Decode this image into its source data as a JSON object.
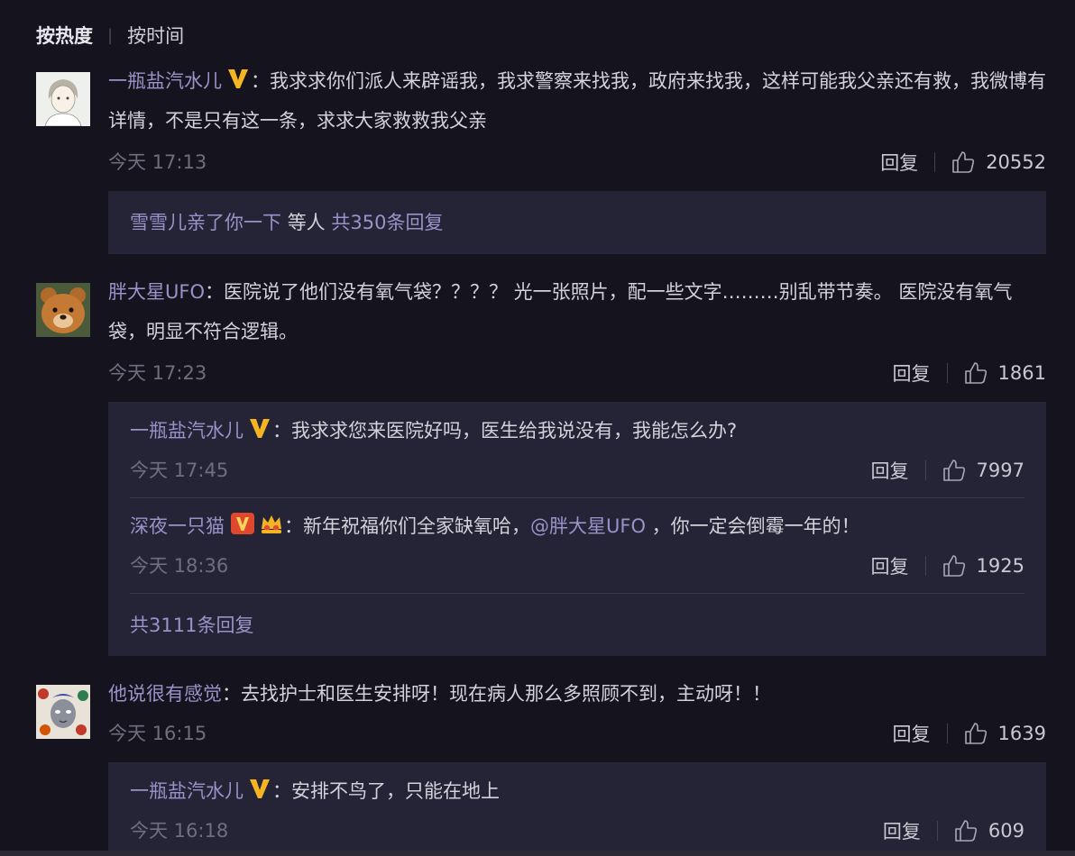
{
  "sort": {
    "hot": "按热度",
    "time": "按时间"
  },
  "comments": [
    {
      "user": "一瓶盐汽水儿",
      "text": "我求求你们派人来辟谣我，我求警察来找我，政府来找我，这样可能我父亲还有救，我微博有详情，不是只有这一条，求求大家救救我父亲",
      "time": "今天 17:13",
      "reply_label": "回复",
      "likes": "20552",
      "replies_summary": {
        "names": "雪雪儿亲了你一下",
        "mid": "等人",
        "count": "共350条回复"
      }
    },
    {
      "user": "胖大星UFO",
      "text": "医院说了他们没有氧气袋？？？？ 光一张照片，配一些文字………别乱带节奏。 医院没有氧气袋，明显不符合逻辑。",
      "time": "今天 17:23",
      "reply_label": "回复",
      "likes": "1861",
      "replies": [
        {
          "user": "一瓶盐汽水儿",
          "text": "我求求您来医院好吗，医生给我说没有，我能怎么办?",
          "time": "今天 17:45",
          "reply_label": "回复",
          "likes": "7997"
        },
        {
          "user": "深夜一只猫",
          "text_a": "新年祝福你们全家缺氧哈，",
          "mention": "@胖大星UFO",
          "text_b": " ，你一定会倒霉一年的！",
          "time": "今天 18:36",
          "reply_label": "回复",
          "likes": "1925"
        }
      ],
      "more": "共3111条回复"
    },
    {
      "user": "他说很有感觉",
      "text": "去找护士和医生安排呀！现在病人那么多照顾不到，主动呀！！",
      "time": "今天 16:15",
      "reply_label": "回复",
      "likes": "1639",
      "replies": [
        {
          "user": "一瓶盐汽水儿",
          "text": "安排不鸟了，只能在地上",
          "time": "今天 16:18",
          "reply_label": "回复",
          "likes": "609"
        }
      ]
    }
  ],
  "colors": {
    "background": "#15131e",
    "reply_box": "#252336",
    "username": "#9a92c8",
    "vip_badge": "#f5b520"
  }
}
